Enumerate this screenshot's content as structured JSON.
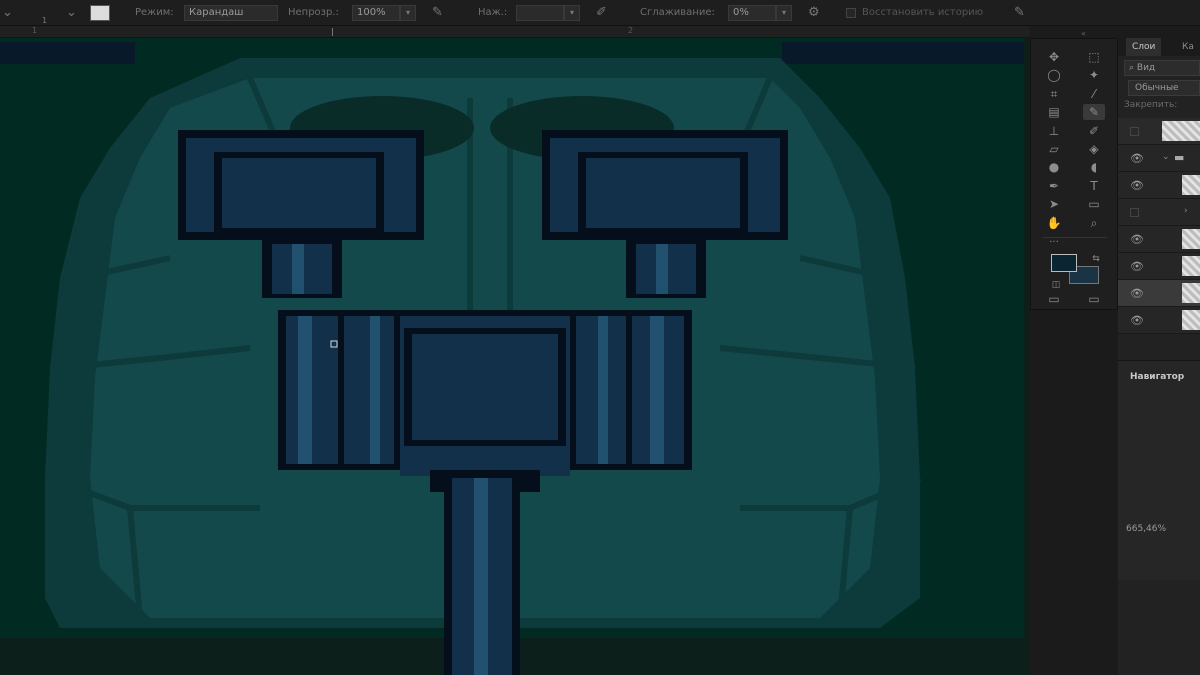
{
  "options_bar": {
    "mode_label": "Режим:",
    "mode_value": "Карандаш",
    "opacity_label": "Непрозр.:",
    "opacity_value": "100%",
    "pressure_label": "Наж.:",
    "pressure_value": "",
    "smoothing_label": "Сглаживание:",
    "smoothing_value": "0%",
    "history_label": "Восстановить историю",
    "brush_size": "1"
  },
  "ruler": {
    "mark1": "1",
    "mark2": "2"
  },
  "colors": {
    "canvas_bg": "#012b22",
    "armor_dark": "#0d3a3a",
    "armor_mid": "#14494b",
    "armor_light": "#1d5a5d",
    "metal_dark": "#050f1c",
    "metal_mid": "#13304a",
    "metal_light": "#22506f",
    "foreground_color": "#0c2533",
    "background_color": "#1a3446"
  },
  "tools": [
    "move-tool",
    "marquee-tool",
    "lasso-tool",
    "magic-wand-tool",
    "crop-tool",
    "eyedropper-tool",
    "healing-tool",
    "pencil-tool",
    "stamp-tool",
    "history-brush-tool",
    "eraser-tool",
    "paint-bucket-tool",
    "blur-tool",
    "dodge-tool",
    "pen-tool",
    "type-tool",
    "path-select-tool",
    "rectangle-tool",
    "hand-tool",
    "zoom-tool"
  ],
  "layers_panel": {
    "tab_layers": "Слои",
    "tab_channels": "Ка",
    "search_placeholder": "Вид",
    "blend_mode": "Обычные",
    "lock_label": "Закрепить:"
  },
  "navigator": {
    "title": "Навигатор",
    "zoom": "665,46%"
  }
}
